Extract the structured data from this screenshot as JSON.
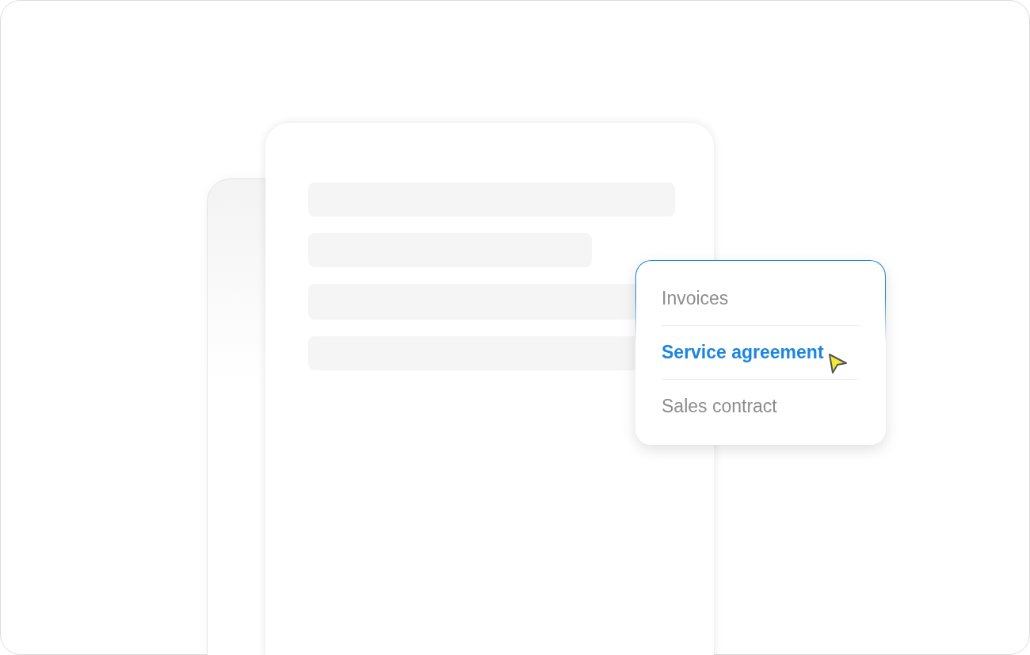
{
  "menu": {
    "items": [
      {
        "label": "Invoices",
        "selected": false
      },
      {
        "label": "Service agreement",
        "selected": true
      },
      {
        "label": "Sales contract",
        "selected": false
      }
    ]
  }
}
